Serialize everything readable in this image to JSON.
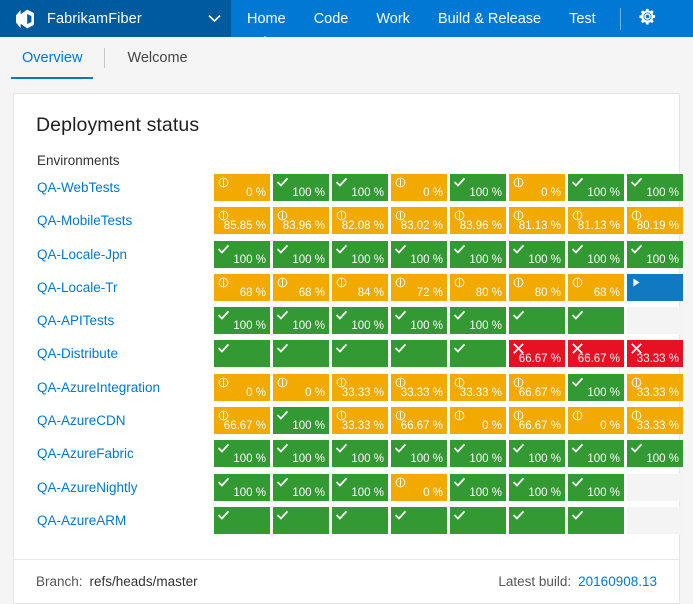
{
  "topbar": {
    "brand": "FabrikamFiber",
    "brand_logo_icon": "vsts-logo-icon",
    "brand_chevron_icon": "chevron-down-icon",
    "gear_icon": "gear-icon",
    "accent_color": "#0078d4",
    "brand_bg_color": "#005a9e",
    "links": [
      {
        "label": "Home",
        "active": true
      },
      {
        "label": "Code",
        "active": false
      },
      {
        "label": "Work",
        "active": false
      },
      {
        "label": "Build & Release",
        "active": false
      },
      {
        "label": "Test",
        "active": false
      }
    ]
  },
  "tabs": [
    {
      "label": "Overview",
      "active": true
    },
    {
      "label": "Welcome",
      "active": false
    }
  ],
  "main": {
    "title": "Deployment status",
    "environments_heading": "Environments",
    "status_colors": {
      "succeeded": "#339933",
      "partial": "#f2a900",
      "failed": "#e81123",
      "inprogress": "#0f7ac2",
      "empty": "#f4f4f4"
    },
    "rows": [
      {
        "environment": "QA-WebTests",
        "tiles": [
          {
            "status": "partial",
            "icon": "partial-icon",
            "pct": "0 %"
          },
          {
            "status": "succeeded",
            "icon": "check-icon",
            "pct": "100 %"
          },
          {
            "status": "succeeded",
            "icon": "check-icon",
            "pct": "100 %"
          },
          {
            "status": "partial",
            "icon": "partial-icon",
            "pct": "0 %"
          },
          {
            "status": "succeeded",
            "icon": "check-icon",
            "pct": "100 %"
          },
          {
            "status": "partial",
            "icon": "partial-icon",
            "pct": "0 %"
          },
          {
            "status": "succeeded",
            "icon": "check-icon",
            "pct": "100 %"
          },
          {
            "status": "succeeded",
            "icon": "check-icon",
            "pct": "100 %"
          }
        ]
      },
      {
        "environment": "QA-MobileTests",
        "tiles": [
          {
            "status": "partial",
            "icon": "partial-icon",
            "pct": "85.85 %"
          },
          {
            "status": "partial",
            "icon": "partial-icon",
            "pct": "83.96 %"
          },
          {
            "status": "partial",
            "icon": "partial-icon",
            "pct": "82.08 %"
          },
          {
            "status": "partial",
            "icon": "partial-icon",
            "pct": "83.02 %"
          },
          {
            "status": "partial",
            "icon": "partial-icon",
            "pct": "83.96 %"
          },
          {
            "status": "partial",
            "icon": "partial-icon",
            "pct": "81.13 %"
          },
          {
            "status": "partial",
            "icon": "partial-icon",
            "pct": "81.13 %"
          },
          {
            "status": "partial",
            "icon": "partial-icon",
            "pct": "80.19 %"
          }
        ]
      },
      {
        "environment": "QA-Locale-Jpn",
        "tiles": [
          {
            "status": "succeeded",
            "icon": "check-icon",
            "pct": "100 %"
          },
          {
            "status": "succeeded",
            "icon": "check-icon",
            "pct": "100 %"
          },
          {
            "status": "succeeded",
            "icon": "check-icon",
            "pct": "100 %"
          },
          {
            "status": "succeeded",
            "icon": "check-icon",
            "pct": "100 %"
          },
          {
            "status": "succeeded",
            "icon": "check-icon",
            "pct": "100 %"
          },
          {
            "status": "succeeded",
            "icon": "check-icon",
            "pct": "100 %"
          },
          {
            "status": "succeeded",
            "icon": "check-icon",
            "pct": "100 %"
          },
          {
            "status": "succeeded",
            "icon": "check-icon",
            "pct": "100 %"
          }
        ]
      },
      {
        "environment": "QA-Locale-Tr",
        "tiles": [
          {
            "status": "partial",
            "icon": "partial-icon",
            "pct": "68 %"
          },
          {
            "status": "partial",
            "icon": "partial-icon",
            "pct": "68 %"
          },
          {
            "status": "partial",
            "icon": "partial-icon",
            "pct": "84 %"
          },
          {
            "status": "partial",
            "icon": "partial-icon",
            "pct": "72 %"
          },
          {
            "status": "partial",
            "icon": "partial-icon",
            "pct": "80 %"
          },
          {
            "status": "partial",
            "icon": "partial-icon",
            "pct": "80 %"
          },
          {
            "status": "partial",
            "icon": "partial-icon",
            "pct": "68 %"
          },
          {
            "status": "inprogress",
            "icon": "play-icon",
            "pct": ""
          }
        ]
      },
      {
        "environment": "QA-APITests",
        "tiles": [
          {
            "status": "succeeded",
            "icon": "check-icon",
            "pct": "100 %"
          },
          {
            "status": "succeeded",
            "icon": "check-icon",
            "pct": "100 %"
          },
          {
            "status": "succeeded",
            "icon": "check-icon",
            "pct": "100 %"
          },
          {
            "status": "succeeded",
            "icon": "check-icon",
            "pct": "100 %"
          },
          {
            "status": "succeeded",
            "icon": "check-icon",
            "pct": "100 %"
          },
          {
            "status": "succeeded",
            "icon": "check-icon",
            "pct": ""
          },
          {
            "status": "succeeded",
            "icon": "check-icon",
            "pct": ""
          },
          {
            "status": "empty",
            "icon": "",
            "pct": ""
          }
        ]
      },
      {
        "environment": "QA-Distribute",
        "tiles": [
          {
            "status": "succeeded",
            "icon": "check-icon",
            "pct": ""
          },
          {
            "status": "succeeded",
            "icon": "check-icon",
            "pct": ""
          },
          {
            "status": "succeeded",
            "icon": "check-icon",
            "pct": ""
          },
          {
            "status": "succeeded",
            "icon": "check-icon",
            "pct": ""
          },
          {
            "status": "succeeded",
            "icon": "check-icon",
            "pct": ""
          },
          {
            "status": "failed",
            "icon": "cross-icon",
            "pct": "66.67 %"
          },
          {
            "status": "failed",
            "icon": "cross-icon",
            "pct": "66.67 %"
          },
          {
            "status": "failed",
            "icon": "cross-icon",
            "pct": "33.33 %"
          }
        ]
      },
      {
        "environment": "QA-AzureIntegration",
        "tiles": [
          {
            "status": "partial",
            "icon": "partial-icon",
            "pct": "0 %"
          },
          {
            "status": "partial",
            "icon": "partial-icon",
            "pct": "0 %"
          },
          {
            "status": "partial",
            "icon": "partial-icon",
            "pct": "33.33 %"
          },
          {
            "status": "partial",
            "icon": "partial-icon",
            "pct": "33.33 %"
          },
          {
            "status": "partial",
            "icon": "partial-icon",
            "pct": "33.33 %"
          },
          {
            "status": "partial",
            "icon": "partial-icon",
            "pct": "66.67 %"
          },
          {
            "status": "succeeded",
            "icon": "check-icon",
            "pct": "100 %"
          },
          {
            "status": "partial",
            "icon": "partial-icon",
            "pct": "33.33 %"
          }
        ]
      },
      {
        "environment": "QA-AzureCDN",
        "tiles": [
          {
            "status": "partial",
            "icon": "partial-icon",
            "pct": "66.67 %"
          },
          {
            "status": "succeeded",
            "icon": "check-icon",
            "pct": "100 %"
          },
          {
            "status": "partial",
            "icon": "partial-icon",
            "pct": "33.33 %"
          },
          {
            "status": "partial",
            "icon": "partial-icon",
            "pct": "66.67 %"
          },
          {
            "status": "partial",
            "icon": "partial-icon",
            "pct": "0 %"
          },
          {
            "status": "partial",
            "icon": "partial-icon",
            "pct": "66.67 %"
          },
          {
            "status": "partial",
            "icon": "partial-icon",
            "pct": "0 %"
          },
          {
            "status": "partial",
            "icon": "partial-icon",
            "pct": "33.33 %"
          }
        ]
      },
      {
        "environment": "QA-AzureFabric",
        "tiles": [
          {
            "status": "succeeded",
            "icon": "check-icon",
            "pct": "100 %"
          },
          {
            "status": "succeeded",
            "icon": "check-icon",
            "pct": "100 %"
          },
          {
            "status": "succeeded",
            "icon": "check-icon",
            "pct": "100 %"
          },
          {
            "status": "succeeded",
            "icon": "check-icon",
            "pct": "100 %"
          },
          {
            "status": "succeeded",
            "icon": "check-icon",
            "pct": "100 %"
          },
          {
            "status": "succeeded",
            "icon": "check-icon",
            "pct": "100 %"
          },
          {
            "status": "succeeded",
            "icon": "check-icon",
            "pct": "100 %"
          },
          {
            "status": "succeeded",
            "icon": "check-icon",
            "pct": "100 %"
          }
        ]
      },
      {
        "environment": "QA-AzureNightly",
        "tiles": [
          {
            "status": "succeeded",
            "icon": "check-icon",
            "pct": "100 %"
          },
          {
            "status": "succeeded",
            "icon": "check-icon",
            "pct": "100 %"
          },
          {
            "status": "succeeded",
            "icon": "check-icon",
            "pct": "100 %"
          },
          {
            "status": "partial",
            "icon": "partial-icon",
            "pct": "0 %"
          },
          {
            "status": "succeeded",
            "icon": "check-icon",
            "pct": "100 %"
          },
          {
            "status": "succeeded",
            "icon": "check-icon",
            "pct": "100 %"
          },
          {
            "status": "succeeded",
            "icon": "check-icon",
            "pct": "100 %"
          },
          {
            "status": "empty",
            "icon": "",
            "pct": ""
          }
        ]
      },
      {
        "environment": "QA-AzureARM",
        "tiles": [
          {
            "status": "succeeded",
            "icon": "check-icon",
            "pct": ""
          },
          {
            "status": "succeeded",
            "icon": "check-icon",
            "pct": ""
          },
          {
            "status": "succeeded",
            "icon": "check-icon",
            "pct": ""
          },
          {
            "status": "succeeded",
            "icon": "check-icon",
            "pct": ""
          },
          {
            "status": "succeeded",
            "icon": "check-icon",
            "pct": ""
          },
          {
            "status": "succeeded",
            "icon": "check-icon",
            "pct": ""
          },
          {
            "status": "succeeded",
            "icon": "check-icon",
            "pct": ""
          },
          {
            "status": "empty",
            "icon": "",
            "pct": ""
          }
        ]
      }
    ]
  },
  "footer": {
    "branch_label": "Branch:",
    "branch_value": "refs/heads/master",
    "build_label": "Latest build:",
    "build_value": "20160908.13"
  }
}
